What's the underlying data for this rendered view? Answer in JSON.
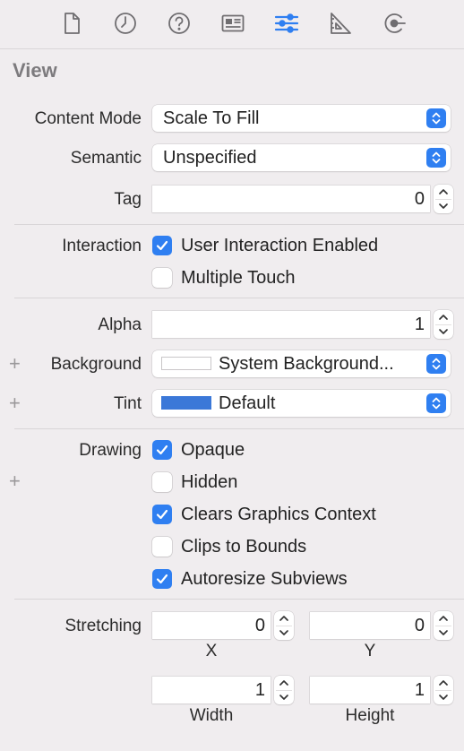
{
  "toolbar": {
    "tabs": [
      {
        "name": "file-inspector",
        "icon": "document-icon"
      },
      {
        "name": "history-inspector",
        "icon": "clock-icon"
      },
      {
        "name": "quick-help-inspector",
        "icon": "help-icon"
      },
      {
        "name": "identity-inspector",
        "icon": "identity-card-icon"
      },
      {
        "name": "attributes-inspector",
        "icon": "sliders-icon",
        "selected": true
      },
      {
        "name": "size-inspector",
        "icon": "ruler-icon"
      },
      {
        "name": "connections-inspector",
        "icon": "connection-arrow-icon"
      }
    ],
    "selected_color": "#2f7ff1"
  },
  "section_title": "View",
  "content_mode": {
    "label": "Content Mode",
    "value": "Scale To Fill"
  },
  "semantic": {
    "label": "Semantic",
    "value": "Unspecified"
  },
  "tag": {
    "label": "Tag",
    "value": "0"
  },
  "interaction": {
    "label": "Interaction",
    "options": [
      {
        "label": "User Interaction Enabled",
        "checked": true
      },
      {
        "label": "Multiple Touch",
        "checked": false
      }
    ]
  },
  "alpha": {
    "label": "Alpha",
    "value": "1"
  },
  "background": {
    "label": "Background",
    "value": "System Background...",
    "swatch_color": "#ffffff"
  },
  "tint": {
    "label": "Tint",
    "value": "Default",
    "swatch_color": "#3b78d8"
  },
  "drawing": {
    "label": "Drawing",
    "options": [
      {
        "label": "Opaque",
        "checked": true
      },
      {
        "label": "Hidden",
        "checked": false
      },
      {
        "label": "Clears Graphics Context",
        "checked": true
      },
      {
        "label": "Clips to Bounds",
        "checked": false
      },
      {
        "label": "Autoresize Subviews",
        "checked": true
      }
    ]
  },
  "stretching": {
    "label": "Stretching",
    "x": {
      "label": "X",
      "value": "0"
    },
    "y": {
      "label": "Y",
      "value": "0"
    },
    "width": {
      "label": "Width",
      "value": "1"
    },
    "height": {
      "label": "Height",
      "value": "1"
    }
  },
  "plus_symbol": "+",
  "accent_color": "#2f7ff1"
}
